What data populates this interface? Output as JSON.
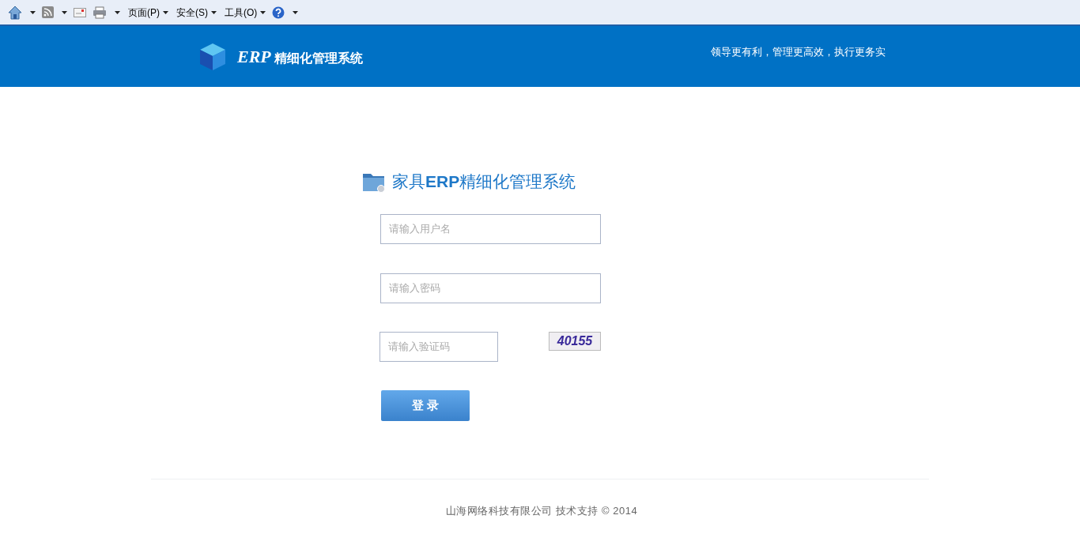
{
  "toolbar": {
    "items": [
      {
        "kind": "home",
        "dropdown": true
      },
      {
        "kind": "feed",
        "dropdown": true
      },
      {
        "kind": "mail",
        "dropdown": false
      },
      {
        "kind": "print",
        "dropdown": true
      },
      {
        "kind": "menu",
        "label": "页面(P)"
      },
      {
        "kind": "menu",
        "label": "安全(S)"
      },
      {
        "kind": "menu",
        "label": "工具(O)"
      },
      {
        "kind": "help",
        "dropdown": true
      }
    ]
  },
  "header": {
    "logo_text": "ERP",
    "logo_subtitle": "精细化管理系统",
    "slogan": "领导更有利，管理更高效，执行更务实"
  },
  "login": {
    "title": "家具**ERP**精细化管理系统",
    "username": {
      "placeholder": "请输入用户名"
    },
    "password": {
      "placeholder": "请输入密码"
    },
    "captcha": {
      "placeholder": "请输入验证码",
      "image_text": "40155"
    },
    "submit": "登 录"
  },
  "footer": {
    "text": "山海网络科技有限公司 技术支持 © 2014"
  }
}
